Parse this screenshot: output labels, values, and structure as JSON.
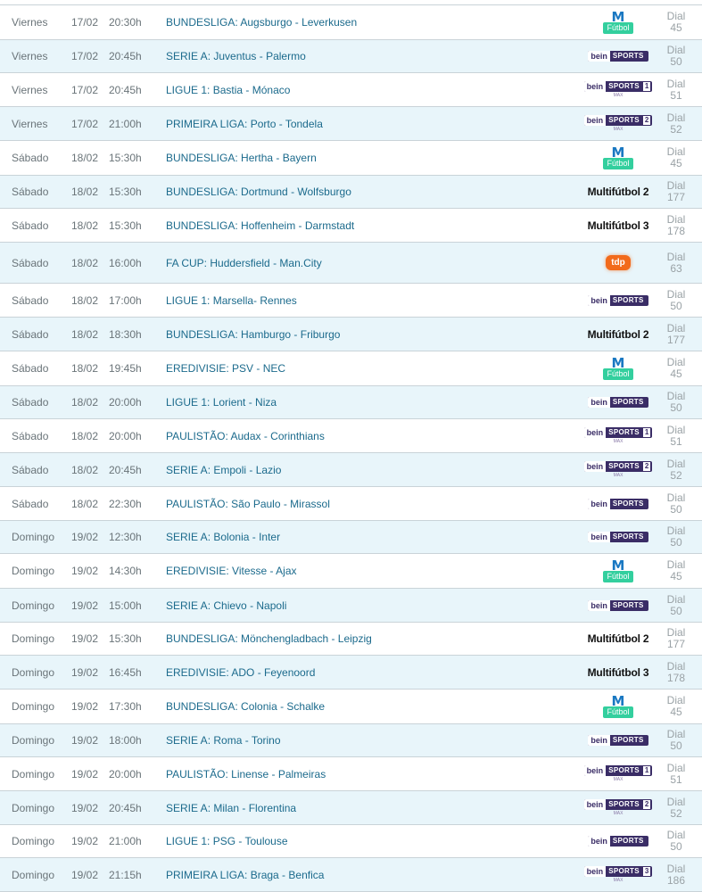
{
  "dial_label": "Dial",
  "rows": [
    {
      "day": "Viernes",
      "date": "17/02",
      "time": "20:30h",
      "competition": "BUNDESLIGA:",
      "teams": "Augsburgo - Leverkusen",
      "channel": {
        "type": "movistar",
        "text": "Fútbol"
      },
      "dial": "45",
      "h": 39
    },
    {
      "day": "Viernes",
      "date": "17/02",
      "time": "20:45h",
      "competition": "SERIE A:",
      "teams": "Juventus - Palermo",
      "channel": {
        "type": "bein",
        "text": "bein SPORTS",
        "num": "",
        "mix": ""
      },
      "dial": "50",
      "h": 37
    },
    {
      "day": "Viernes",
      "date": "17/02",
      "time": "20:45h",
      "competition": "LIGUE 1:",
      "teams": "Bastia - Mónaco",
      "channel": {
        "type": "bein",
        "text": "bein SPORTS",
        "num": "1",
        "mix": "MAX"
      },
      "dial": "51",
      "h": 38
    },
    {
      "day": "Viernes",
      "date": "17/02",
      "time": "21:00h",
      "competition": "PRIMEIRA LIGA:",
      "teams": "Porto - Tondela",
      "channel": {
        "type": "bein",
        "text": "bein SPORTS",
        "num": "2",
        "mix": "MAX"
      },
      "dial": "52",
      "h": 38
    },
    {
      "day": "Sábado",
      "date": "18/02",
      "time": "15:30h",
      "competition": "BUNDESLIGA:",
      "teams": "Hertha - Bayern",
      "channel": {
        "type": "movistar",
        "text": "Fútbol"
      },
      "dial": "45",
      "h": 39
    },
    {
      "day": "Sábado",
      "date": "18/02",
      "time": "15:30h",
      "competition": "BUNDESLIGA:",
      "teams": "Dortmund - Wolfsburgo",
      "channel": {
        "type": "multi",
        "text": "Multifútbol 2"
      },
      "dial": "177",
      "h": 37
    },
    {
      "day": "Sábado",
      "date": "18/02",
      "time": "15:30h",
      "competition": "BUNDESLIGA:",
      "teams": "Hoffenheim - Darmstadt",
      "channel": {
        "type": "multi",
        "text": "Multifútbol 3"
      },
      "dial": "178",
      "h": 38
    },
    {
      "day": "Sábado",
      "date": "18/02",
      "time": "16:00h",
      "competition": "FA CUP:",
      "teams": "Huddersfield - Man.City",
      "channel": {
        "type": "tdp",
        "text": "tdp"
      },
      "dial": "63",
      "h": 46
    },
    {
      "day": "Sábado",
      "date": "18/02",
      "time": "17:00h",
      "competition": "LIGUE 1:",
      "teams": "Marsella- Rennes",
      "channel": {
        "type": "bein",
        "text": "bein SPORTS",
        "num": "",
        "mix": ""
      },
      "dial": "50",
      "h": 38
    },
    {
      "day": "Sábado",
      "date": "18/02",
      "time": "18:30h",
      "competition": "BUNDESLIGA:",
      "teams": "Hamburgo - Friburgo",
      "channel": {
        "type": "multi",
        "text": "Multifútbol 2"
      },
      "dial": "177",
      "h": 38
    },
    {
      "day": "Sábado",
      "date": "18/02",
      "time": "19:45h",
      "competition": "EREDIVISIE:",
      "teams": "PSV - NEC",
      "channel": {
        "type": "movistar",
        "text": "Fútbol"
      },
      "dial": "45",
      "h": 39
    },
    {
      "day": "Sábado",
      "date": "18/02",
      "time": "20:00h",
      "competition": "LIGUE 1:",
      "teams": "Lorient - Niza",
      "channel": {
        "type": "bein",
        "text": "bein SPORTS",
        "num": "",
        "mix": ""
      },
      "dial": "50",
      "h": 37
    },
    {
      "day": "Sábado",
      "date": "18/02",
      "time": "20:00h",
      "competition": "PAULISTÃO:",
      "teams": "Audax - Corinthians",
      "channel": {
        "type": "bein",
        "text": "bein SPORTS",
        "num": "1",
        "mix": "MAX"
      },
      "dial": "51",
      "h": 38
    },
    {
      "day": "Sábado",
      "date": "18/02",
      "time": "20:45h",
      "competition": "SERIE A:",
      "teams": "Empoli - Lazio",
      "channel": {
        "type": "bein",
        "text": "bein SPORTS",
        "num": "2",
        "mix": "MAX"
      },
      "dial": "52",
      "h": 38
    },
    {
      "day": "Sábado",
      "date": "18/02",
      "time": "22:30h",
      "competition": "PAULISTÃO:",
      "teams": "São Paulo - Mirassol",
      "channel": {
        "type": "bein",
        "text": "bein SPORTS",
        "num": "",
        "mix": ""
      },
      "dial": "50",
      "h": 38
    },
    {
      "day": "Domingo",
      "date": "19/02",
      "time": "12:30h",
      "competition": "SERIE A:",
      "teams": "Bolonia - Inter",
      "channel": {
        "type": "bein",
        "text": "bein SPORTS",
        "num": "",
        "mix": ""
      },
      "dial": "50",
      "h": 37
    },
    {
      "day": "Domingo",
      "date": "19/02",
      "time": "14:30h",
      "competition": "EREDIVISIE:",
      "teams": "Vitesse - Ajax",
      "channel": {
        "type": "movistar",
        "text": "Fútbol"
      },
      "dial": "45",
      "h": 39
    },
    {
      "day": "Domingo",
      "date": "19/02",
      "time": "15:00h",
      "competition": "SERIE A:",
      "teams": "Chievo - Napoli",
      "channel": {
        "type": "bein",
        "text": "bein SPORTS",
        "num": "",
        "mix": ""
      },
      "dial": "50",
      "h": 38
    },
    {
      "day": "Domingo",
      "date": "19/02",
      "time": "15:30h",
      "competition": "BUNDESLIGA:",
      "teams": "Mönchengladbach - Leipzig",
      "channel": {
        "type": "multi",
        "text": "Multifútbol 2"
      },
      "dial": "177",
      "h": 37
    },
    {
      "day": "Domingo",
      "date": "19/02",
      "time": "16:45h",
      "competition": "EREDIVISIE:",
      "teams": "ADO - Feyenoord",
      "channel": {
        "type": "multi",
        "text": "Multifútbol 3"
      },
      "dial": "178",
      "h": 38
    },
    {
      "day": "Domingo",
      "date": "19/02",
      "time": "17:30h",
      "competition": "BUNDESLIGA:",
      "teams": "Colonia - Schalke",
      "channel": {
        "type": "movistar",
        "text": "Fútbol"
      },
      "dial": "45",
      "h": 39
    },
    {
      "day": "Domingo",
      "date": "19/02",
      "time": "18:00h",
      "competition": "SERIE A:",
      "teams": "Roma - Torino",
      "channel": {
        "type": "bein",
        "text": "bein SPORTS",
        "num": "",
        "mix": ""
      },
      "dial": "50",
      "h": 37
    },
    {
      "day": "Domingo",
      "date": "19/02",
      "time": "20:00h",
      "competition": "PAULISTÃO:",
      "teams": "Linense - Palmeiras",
      "channel": {
        "type": "bein",
        "text": "bein SPORTS",
        "num": "1",
        "mix": "MAX"
      },
      "dial": "51",
      "h": 38
    },
    {
      "day": "Domingo",
      "date": "19/02",
      "time": "20:45h",
      "competition": "SERIE A:",
      "teams": "Milan - Florentina",
      "channel": {
        "type": "bein",
        "text": "bein SPORTS",
        "num": "2",
        "mix": "MAX"
      },
      "dial": "52",
      "h": 38
    },
    {
      "day": "Domingo",
      "date": "19/02",
      "time": "21:00h",
      "competition": "LIGUE 1:",
      "teams": "PSG - Toulouse",
      "channel": {
        "type": "bein",
        "text": "bein SPORTS",
        "num": "",
        "mix": ""
      },
      "dial": "50",
      "h": 37
    },
    {
      "day": "Domingo",
      "date": "19/02",
      "time": "21:15h",
      "competition": "PRIMEIRA LIGA:",
      "teams": "Braga - Benfica",
      "channel": {
        "type": "bein",
        "text": "bein SPORTS",
        "num": "3",
        "mix": "MAX"
      },
      "dial": "186",
      "h": 39
    }
  ]
}
